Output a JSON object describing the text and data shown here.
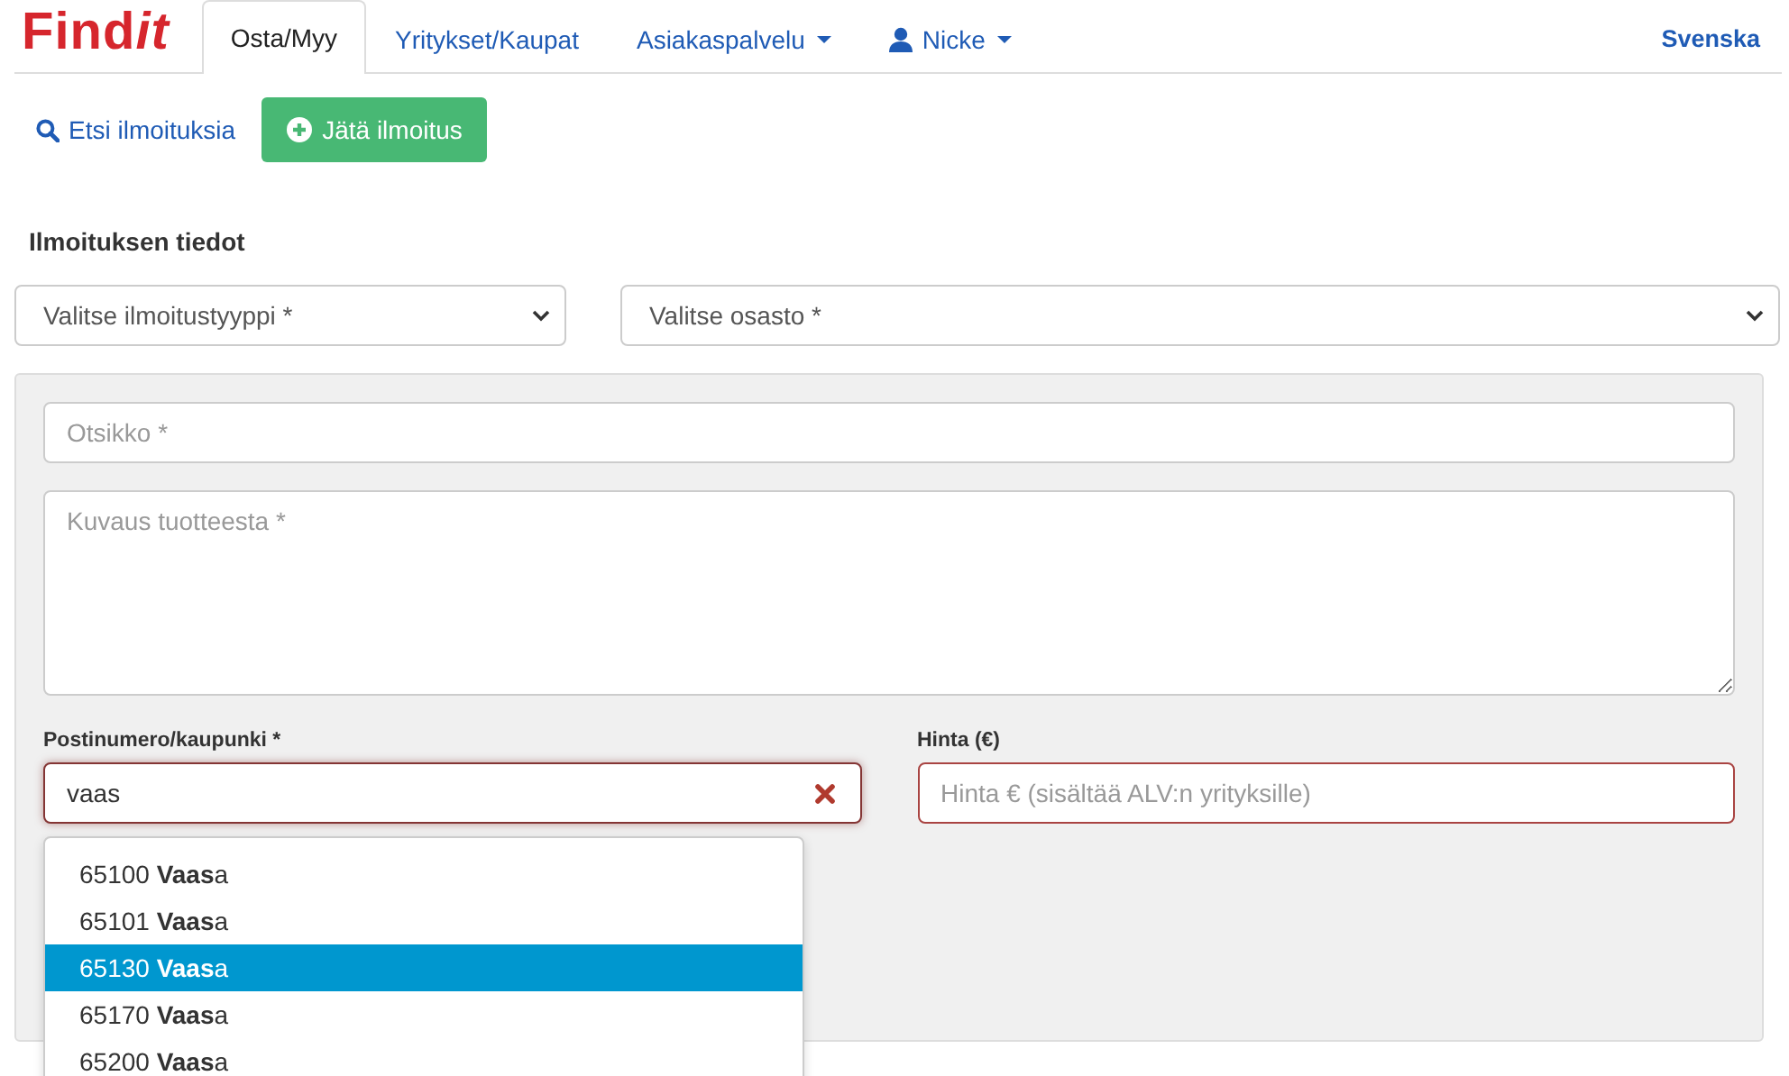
{
  "logo": {
    "main": "Find",
    "accent": "it"
  },
  "nav": {
    "tabs": [
      {
        "label": "Osta/Myy",
        "selected": true,
        "kind": "plain"
      },
      {
        "label": "Yritykset/Kaupat",
        "selected": false,
        "kind": "plain"
      },
      {
        "label": "Asiakaspalvelu",
        "selected": false,
        "kind": "dropdown"
      },
      {
        "label": "Nicke",
        "selected": false,
        "kind": "user"
      }
    ],
    "language": "Svenska"
  },
  "actions": {
    "search_link": "Etsi ilmoituksia",
    "create_button": "Jätä ilmoitus"
  },
  "form": {
    "section_title": "Ilmoituksen tiedot",
    "selects": [
      {
        "value": "Valitse ilmoitustyyppi *"
      },
      {
        "value": "Valitse osasto *"
      }
    ],
    "title_field": {
      "placeholder": "Otsikko *"
    },
    "description_field": {
      "placeholder": "Kuvaus tuotteesta *"
    },
    "location": {
      "label": "Postinumero/kaupunki *",
      "value": "vaas"
    },
    "price": {
      "label": "Hinta (€)",
      "placeholder": "Hinta € (sisältää ALV:n yrityksille)"
    },
    "suggestions": [
      {
        "text": "65100 **Vaas**a",
        "selected": false
      },
      {
        "text": "65101 **Vaas**a",
        "selected": false
      },
      {
        "text": "65130 **Vaas**a",
        "selected": true
      },
      {
        "text": "65170 **Vaas**a",
        "selected": false
      },
      {
        "text": "65200 **Vaas**a",
        "selected": false
      }
    ]
  }
}
